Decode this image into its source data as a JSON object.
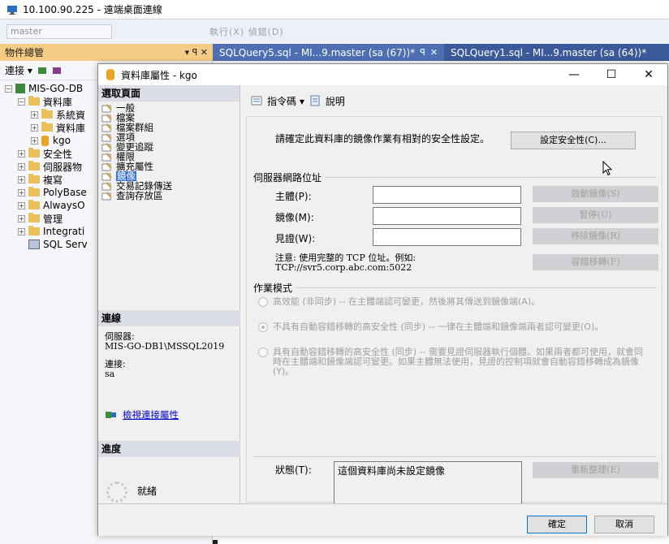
{
  "rdp": {
    "title": "10.100.90.225 - 遠端桌面連線"
  },
  "ssms": {
    "toolbar": {
      "db_combo": "master",
      "rest": "執行(X)   偵錯(D)"
    },
    "object_explorer": {
      "tab_label": "物件總管",
      "pin": "▾ ꟼ ✕",
      "toolbar_label": "連接 ▾",
      "tree": [
        {
          "label": "MIS-GO-DB",
          "indent": 0,
          "expanded": true,
          "icon": "server-icon"
        },
        {
          "label": "資料庫",
          "indent": 1,
          "expanded": true,
          "icon": "folder-icon"
        },
        {
          "label": "系統資",
          "indent": 2,
          "expanded": false,
          "icon": "folder-icon"
        },
        {
          "label": "資料庫",
          "indent": 2,
          "expanded": false,
          "icon": "folder-icon"
        },
        {
          "label": "kgo",
          "indent": 2,
          "expanded": false,
          "icon": "database-icon"
        },
        {
          "label": "安全性",
          "indent": 1,
          "expanded": false,
          "icon": "folder-icon"
        },
        {
          "label": "伺服器物",
          "indent": 1,
          "expanded": false,
          "icon": "folder-icon"
        },
        {
          "label": "複寫",
          "indent": 1,
          "expanded": false,
          "icon": "folder-icon"
        },
        {
          "label": "PolyBase",
          "indent": 1,
          "expanded": false,
          "icon": "folder-icon"
        },
        {
          "label": "AlwaysO",
          "indent": 1,
          "expanded": false,
          "icon": "folder-icon"
        },
        {
          "label": "管理",
          "indent": 1,
          "expanded": false,
          "icon": "folder-icon"
        },
        {
          "label": "Integrati",
          "indent": 1,
          "expanded": false,
          "icon": "folder-icon"
        },
        {
          "label": "SQL Serv",
          "indent": 1,
          "expanded": null,
          "icon": "agent-icon"
        }
      ]
    },
    "doc_tabs": [
      {
        "label": "SQLQuery5.sql - MI...9.master (sa (67))*",
        "pin": "ꟼ",
        "close": "✕",
        "active": true
      },
      {
        "label": "SQLQuery1.sql - MI...9.master (sa (64))*",
        "active": false
      }
    ]
  },
  "dialog": {
    "title": "資料庫屬性 - kgo",
    "controls": {
      "minimize": "—",
      "maximize": "☐",
      "close": "✕"
    },
    "sidebar": {
      "header": "選取頁面",
      "pages": [
        "一般",
        "檔案",
        "檔案群組",
        "選項",
        "變更追蹤",
        "權限",
        "擴充屬性",
        "鏡像",
        "交易記錄傳送",
        "查詢存放區"
      ],
      "selected_index": 7,
      "connection_header": "連線",
      "server_label": "伺服器:",
      "server_value": "MIS-GO-DB1\\MSSQL2019",
      "connection_label": "連接:",
      "connection_value": "sa",
      "view_conn_link": "檢視連接屬性",
      "progress_header": "進度",
      "progress_status": "就緒"
    },
    "toolbar": {
      "script": "指令碼 ▾",
      "help": "說明"
    },
    "mirroring": {
      "description": "請確定此資料庫的鏡像作業有相對的安全性設定。",
      "configure_security_btn": "設定安全性(C)...",
      "server_network_group": "伺服器網路位址",
      "principal_label": "主體(P):",
      "mirror_label": "鏡像(M):",
      "witness_label": "見證(W):",
      "principal_value": "",
      "mirror_value": "",
      "witness_value": "",
      "start_mirroring_btn": "啟動鏡像(S)",
      "pause_btn": "暫停(U)",
      "remove_mirroring_btn": "移除鏡像(R)",
      "failover_btn": "容錯移轉(F)",
      "note_line1": "注意: 使用完整的 TCP 位址。例如:",
      "note_line2": "TCP://svr5.corp.abc.com:5022",
      "operating_mode_group": "作業模式",
      "mode_high_perf": "高效能 (非同步) -- 在主體端認可變更，然後將其傳送到鏡像端(A)。",
      "mode_high_safety": "不具有自動容錯移轉的高安全性 (同步) -- 一律在主體端和鏡像端兩者認可變更(O)。",
      "mode_high_safety_auto": "具有自動容錯移轉的高安全性 (同步) -- 需要見證伺服器執行個體。如果兩者都可使用，就會同時在主體端和鏡像端認可變更。如果主體無法使用，見證的控制項就會自動容錯移轉成為鏡像(Y)。",
      "selected_mode": "high_safety",
      "status_label": "狀態(T):",
      "status_value": "這個資料庫尚未設定鏡像",
      "refresh_btn": "重新整理(E)"
    },
    "footer": {
      "ok": "確定",
      "cancel": "取消"
    }
  },
  "colors": {
    "tab_bar": "#3c5a99",
    "oe_tab": "#f5cc84",
    "selected_page": "#3370d8",
    "link": "#0000cc",
    "ok_border": "#0078d7"
  }
}
